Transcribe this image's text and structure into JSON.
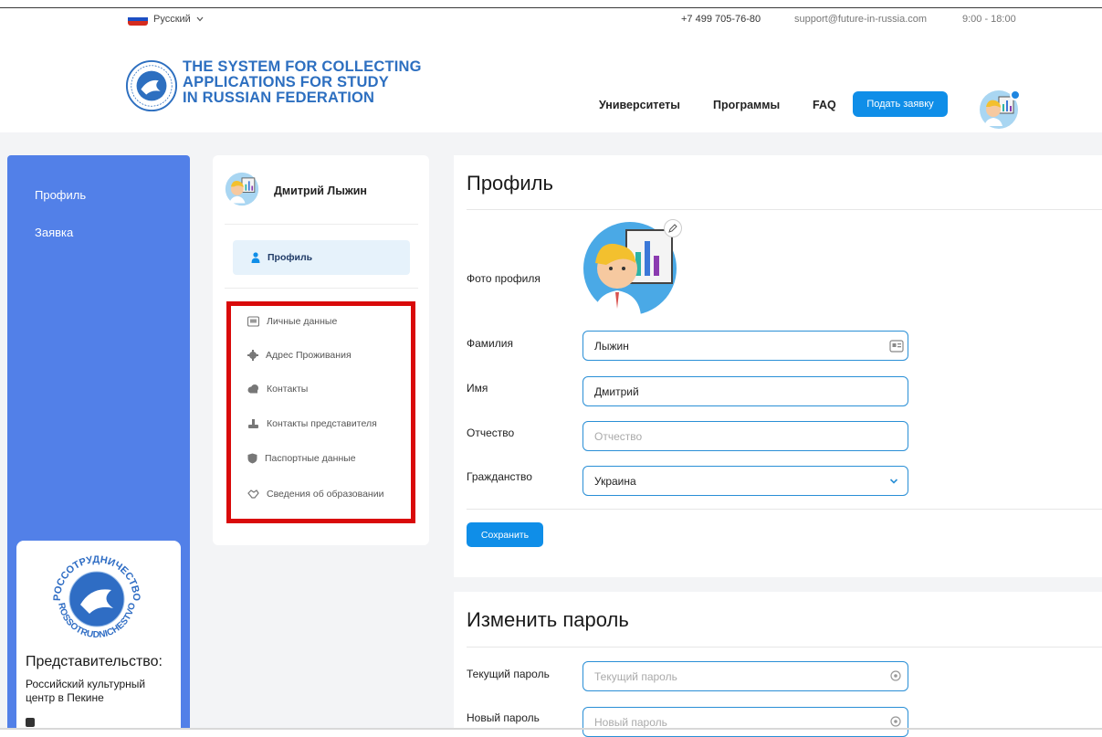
{
  "topbar": {
    "language": "Русский",
    "phone": "+7 499 705-76-80",
    "email": "support@future-in-russia.com",
    "hours": "9:00 - 18:00"
  },
  "header": {
    "logo_line1": "THE SYSTEM FOR COLLECTING",
    "logo_line2": "APPLICATIONS FOR STUDY",
    "logo_line3": "IN RUSSIAN FEDERATION",
    "nav": [
      "Университеты",
      "Программы",
      "FAQ"
    ],
    "apply_label": "Подать заявку",
    "logo_emblem_text": "РОССОТРУДНИЧЕСТВО"
  },
  "sidebar": {
    "items": [
      {
        "label": "Профиль"
      },
      {
        "label": "Заявка"
      }
    ],
    "representation": {
      "title": "Представительство:",
      "text": "Российский культурный центр в Пекине",
      "emblem_top": "РОССОТРУДНИЧЕСТВО",
      "emblem_bottom": "ROSSOTRUDNICHESTVO"
    }
  },
  "profile_card": {
    "user_name": "Дмитрий Лыжин",
    "active_item": "Профиль",
    "menu": [
      {
        "label": "Личные данные",
        "icon": "id-card-icon"
      },
      {
        "label": "Адрес Проживания",
        "icon": "gear-icon"
      },
      {
        "label": "Контакты",
        "icon": "cloud-icon"
      },
      {
        "label": "Контакты представителя",
        "icon": "hand-icon"
      },
      {
        "label": "Паспортные данные",
        "icon": "shield-icon"
      },
      {
        "label": "Сведения об образовании",
        "icon": "handshake-icon"
      }
    ]
  },
  "profile_form": {
    "title": "Профиль",
    "photo_label": "Фото профиля",
    "surname_label": "Фамилия",
    "surname_value": "Лыжин",
    "name_label": "Имя",
    "name_value": "Дмитрий",
    "patronymic_label": "Отчество",
    "patronymic_placeholder": "Отчество",
    "citizenship_label": "Гражданство",
    "citizenship_value": "Украина",
    "save_label": "Сохранить"
  },
  "password_form": {
    "title": "Изменить пароль",
    "current_label": "Текущий пароль",
    "current_placeholder": "Текущий пароль",
    "new_label": "Новый пароль",
    "new_placeholder": "Новый пароль"
  },
  "colors": {
    "accent": "#0f8ee8",
    "sidebar": "#5280e8",
    "highlight": "#d90a0a",
    "logo_text": "#2d6fc0"
  }
}
